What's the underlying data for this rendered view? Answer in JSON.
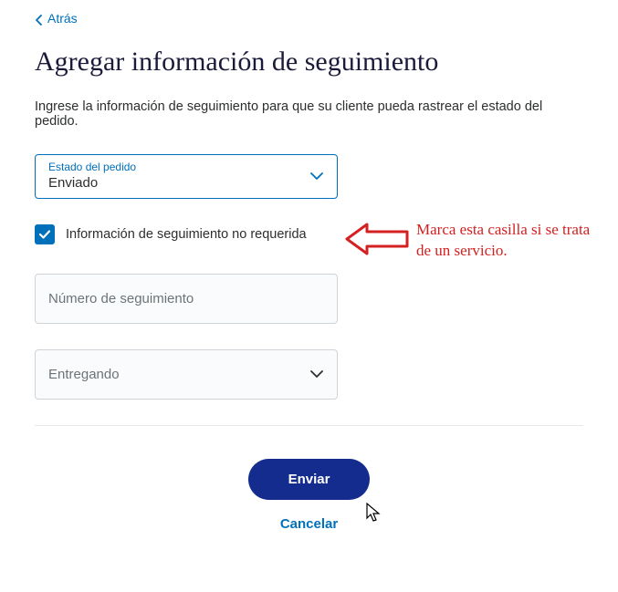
{
  "nav": {
    "back_label": "Atrás"
  },
  "header": {
    "title": "Agregar información de seguimiento",
    "instruction": "Ingrese la información de seguimiento para que su cliente pueda rastrear el estado del pedido."
  },
  "order_status": {
    "label": "Estado del pedido",
    "value": "Enviado"
  },
  "tracking_not_required": {
    "label": "Información de seguimiento no requerida",
    "checked": true
  },
  "tracking_number": {
    "placeholder": "Número de seguimiento"
  },
  "carrier": {
    "placeholder": "Entregando"
  },
  "actions": {
    "submit_label": "Enviar",
    "cancel_label": "Cancelar"
  },
  "annotation": {
    "text": "Marca esta casilla si se trata de un servicio.",
    "color": "#d42020"
  }
}
